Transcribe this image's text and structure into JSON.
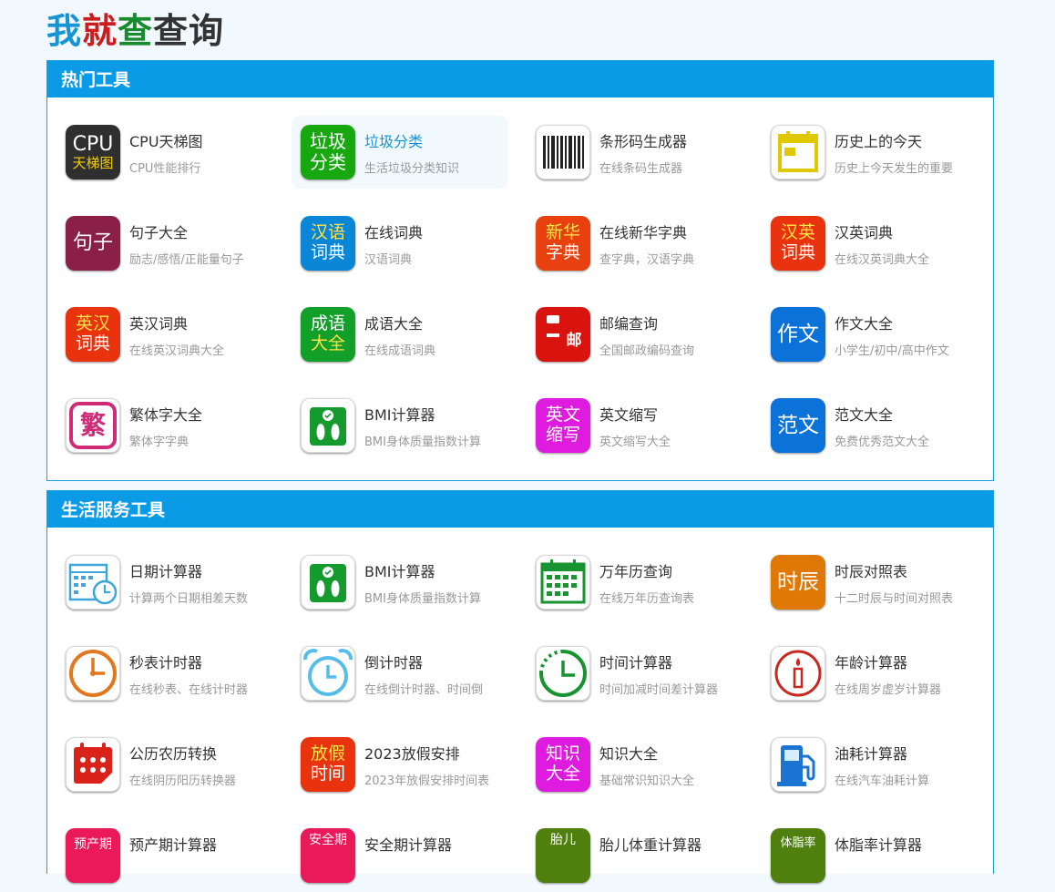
{
  "logo": {
    "c1": "我",
    "c2": "就",
    "c3": "查",
    "c4": "查询"
  },
  "colors": {
    "header": "#0a9ae6",
    "accent": "#1694d4"
  },
  "sections": [
    {
      "title": "热门工具",
      "tools": [
        {
          "name": "CPU天梯图",
          "desc": "CPU性能排行",
          "icon": "cpu-ladder-icon",
          "l1": "CPU",
          "l2": "天梯图"
        },
        {
          "name": "垃圾分类",
          "desc": "生活垃圾分类知识",
          "icon": "garbage-sort-icon",
          "l1": "垃圾",
          "l2": "分类"
        },
        {
          "name": "条形码生成器",
          "desc": "在线条码生成器",
          "icon": "barcode-icon"
        },
        {
          "name": "历史上的今天",
          "desc": "历史上今天发生的重要",
          "icon": "calendar-day-icon"
        },
        {
          "name": "句子大全",
          "desc": "励志/感悟/正能量句子",
          "icon": "sentence-icon",
          "l1": "句子"
        },
        {
          "name": "在线词典",
          "desc": "汉语词典",
          "icon": "chinese-dictionary-icon",
          "l1": "汉语",
          "l2": "词典"
        },
        {
          "name": "在线新华字典",
          "desc": "查字典，汉语字典",
          "icon": "xinhua-dictionary-icon",
          "l1": "新华",
          "l2": "字典"
        },
        {
          "name": "汉英词典",
          "desc": "在线汉英词典大全",
          "icon": "chinese-english-icon",
          "l1": "汉英",
          "l2": "词典"
        },
        {
          "name": "英汉词典",
          "desc": "在线英汉词典大全",
          "icon": "english-chinese-icon",
          "l1": "英汉",
          "l2": "词典"
        },
        {
          "name": "成语大全",
          "desc": "在线成语词典",
          "icon": "idiom-icon",
          "l1": "成语",
          "l2": "大全"
        },
        {
          "name": "邮编查询",
          "desc": "全国邮政编码查询",
          "icon": "postcode-icon",
          "l1": "邮"
        },
        {
          "name": "作文大全",
          "desc": "小学生/初中/高中作文",
          "icon": "essay-icon",
          "l1": "作文"
        },
        {
          "name": "繁体字大全",
          "desc": "繁体字字典",
          "icon": "traditional-char-icon",
          "l1": "繁"
        },
        {
          "name": "BMI计算器",
          "desc": "BMI身体质量指数计算",
          "icon": "scale-icon"
        },
        {
          "name": "英文缩写",
          "desc": "英文缩写大全",
          "icon": "abbreviation-icon",
          "l1": "英文",
          "l2": "缩写"
        },
        {
          "name": "范文大全",
          "desc": "免费优秀范文大全",
          "icon": "model-essay-icon",
          "l1": "范文"
        }
      ]
    },
    {
      "title": "生活服务工具",
      "tools": [
        {
          "name": "日期计算器",
          "desc": "计算两个日期相差天数",
          "icon": "date-calculator-icon"
        },
        {
          "name": "BMI计算器",
          "desc": "BMI身体质量指数计算",
          "icon": "scale-icon"
        },
        {
          "name": "万年历查询",
          "desc": "在线万年历查询表",
          "icon": "perpetual-calendar-icon"
        },
        {
          "name": "时辰对照表",
          "desc": "十二时辰与时间对照表",
          "icon": "shichen-icon",
          "l1": "时辰"
        },
        {
          "name": "秒表计时器",
          "desc": "在线秒表、在线计时器",
          "icon": "stopwatch-icon"
        },
        {
          "name": "倒计时器",
          "desc": "在线倒计时器、时间倒",
          "icon": "alarm-clock-icon"
        },
        {
          "name": "时间计算器",
          "desc": "时间加减时间差计算器",
          "icon": "time-calculator-icon"
        },
        {
          "name": "年龄计算器",
          "desc": "在线周岁虚岁计算器",
          "icon": "age-candle-icon"
        },
        {
          "name": "公历农历转换",
          "desc": "在线阴历阳历转换器",
          "icon": "lunar-calendar-icon"
        },
        {
          "name": "2023放假安排",
          "desc": "2023年放假安排时间表",
          "icon": "holiday-icon",
          "l1": "放假",
          "l2": "时间"
        },
        {
          "name": "知识大全",
          "desc": "基础常识知识大全",
          "icon": "knowledge-icon",
          "l1": "知识",
          "l2": "大全"
        },
        {
          "name": "油耗计算器",
          "desc": "在线汽车油耗计算",
          "icon": "fuel-pump-icon"
        },
        {
          "name": "预产期计算器",
          "desc": "",
          "icon": "due-date-icon",
          "l1": "预产期"
        },
        {
          "name": "安全期计算器",
          "desc": "",
          "icon": "safe-period-icon",
          "l1": "安全期"
        },
        {
          "name": "胎儿体重计算器",
          "desc": "",
          "icon": "fetal-weight-icon",
          "l1": "胎儿"
        },
        {
          "name": "体脂率计算器",
          "desc": "",
          "icon": "body-fat-icon",
          "l1": "体脂率"
        }
      ]
    }
  ]
}
